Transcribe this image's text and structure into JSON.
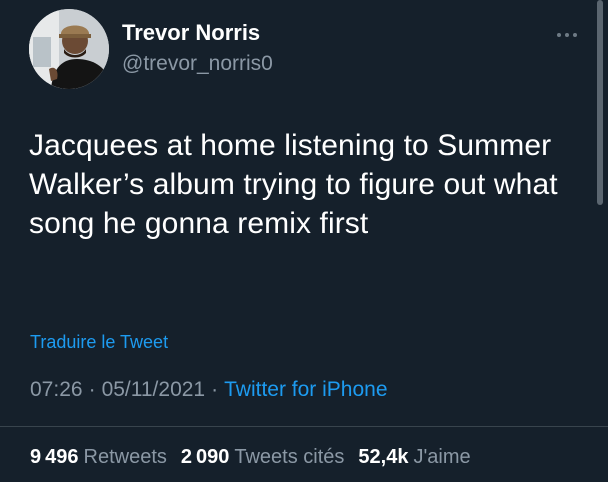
{
  "author": {
    "name": "Trevor Norris",
    "handle": "@trevor_norris0"
  },
  "tweet": {
    "text": "Jacquees at home listening to Summer Walker’s album trying to figure out what song he gonna remix first"
  },
  "translate_label": "Traduire le Tweet",
  "meta": {
    "time": "07:26",
    "separator": "·",
    "date": "05/11/2021",
    "source": "Twitter for iPhone"
  },
  "stats": {
    "retweets_count": "9 496",
    "retweets_label": "Retweets",
    "quotes_count": "2 090",
    "quotes_label": "Tweets cités",
    "likes_count": "52,4k",
    "likes_label": "J'aime"
  },
  "icons": {
    "more": "more-horizontal-icon",
    "avatar": "profile-avatar"
  },
  "colors": {
    "background": "#15202b",
    "text": "#ffffff",
    "secondary": "#8b98a5",
    "link": "#1d9bf0",
    "divider": "#38444d"
  }
}
